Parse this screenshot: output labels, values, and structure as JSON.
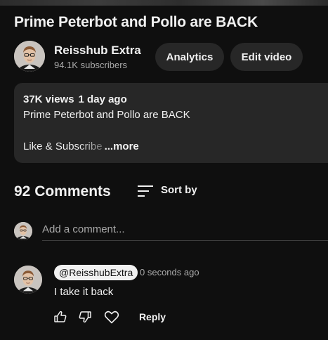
{
  "video": {
    "title": "Prime Peterbot and Pollo are BACK"
  },
  "channel": {
    "name": "Reisshub Extra",
    "subscribers": "94.1K subscribers"
  },
  "owner_actions": {
    "analytics_label": "Analytics",
    "edit_label": "Edit video"
  },
  "description": {
    "views": "37K views",
    "age": "1 day ago",
    "line1": "Prime Peterbot and Pollo are BACK",
    "line2": "Like & Subscribe",
    "more_label": "...more"
  },
  "comments": {
    "count_label": "92 Comments",
    "sort_label": "Sort by",
    "add_placeholder": "Add a comment...",
    "items": [
      {
        "author": "@ReisshubExtra",
        "time": "0 seconds ago",
        "text": "I take it back",
        "reply_label": "Reply"
      }
    ]
  },
  "icons": {
    "sort": "sort-icon",
    "like": "thumb-up-icon",
    "dislike": "thumb-down-icon",
    "heart": "heart-icon"
  },
  "colors": {
    "background": "#0f0f0f",
    "surface": "#272727",
    "text_primary": "#f1f1f1",
    "text_secondary": "#aaaaaa"
  }
}
